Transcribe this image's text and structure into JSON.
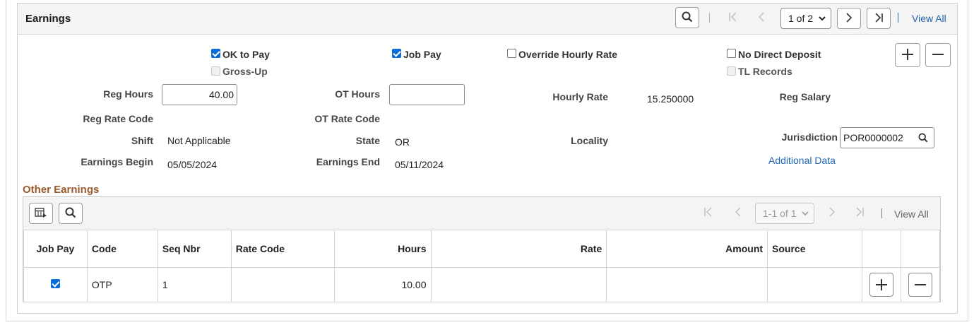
{
  "earnings": {
    "title": "Earnings",
    "pager": {
      "selected": "1 of 2",
      "view_all": "View All"
    },
    "checkboxes": {
      "ok_to_pay": {
        "label": "OK to Pay",
        "checked": true
      },
      "gross_up": {
        "label": "Gross-Up",
        "checked": false,
        "disabled": true
      },
      "job_pay": {
        "label": "Job Pay",
        "checked": true
      },
      "override_hourly_rate": {
        "label": "Override Hourly Rate",
        "checked": false
      },
      "no_direct_deposit": {
        "label": "No Direct Deposit",
        "checked": false
      },
      "tl_records": {
        "label": "TL Records",
        "checked": false,
        "disabled": true
      }
    },
    "fields": {
      "reg_hours_label": "Reg Hours",
      "reg_hours_value": "40.00",
      "ot_hours_label": "OT Hours",
      "ot_hours_value": "",
      "hourly_rate_label": "Hourly Rate",
      "hourly_rate_value": "15.250000",
      "reg_salary_label": "Reg Salary",
      "reg_rate_code_label": "Reg Rate Code",
      "ot_rate_code_label": "OT Rate Code",
      "shift_label": "Shift",
      "shift_value": "Not Applicable",
      "state_label": "State",
      "state_value": "OR",
      "locality_label": "Locality",
      "jurisdiction_label": "Jurisdiction",
      "jurisdiction_value": "POR0000002",
      "earnings_begin_label": "Earnings Begin",
      "earnings_begin_value": "05/05/2024",
      "earnings_end_label": "Earnings End",
      "earnings_end_value": "05/11/2024",
      "additional_data_link": "Additional Data"
    }
  },
  "other_earnings": {
    "title": "Other Earnings",
    "pager": {
      "selected": "1-1 of 1",
      "view_all": "View All"
    },
    "columns": [
      "Job Pay",
      "Code",
      "Seq Nbr",
      "Rate Code",
      "Hours",
      "Rate",
      "Amount",
      "Source"
    ],
    "rows": [
      {
        "job_pay": true,
        "code": "OTP",
        "seq_nbr": "1",
        "rate_code": "",
        "hours": "10.00",
        "rate": "",
        "amount": "",
        "source": ""
      }
    ]
  },
  "colors": {
    "link": "#1f64b0",
    "section_title": "#9c5a2c",
    "checkbox_checked": "#0a6cd6"
  },
  "icons": [
    "search-icon",
    "first-page-icon",
    "previous-icon",
    "next-icon",
    "last-page-icon",
    "add-icon",
    "remove-icon",
    "personalize-grid-icon"
  ]
}
